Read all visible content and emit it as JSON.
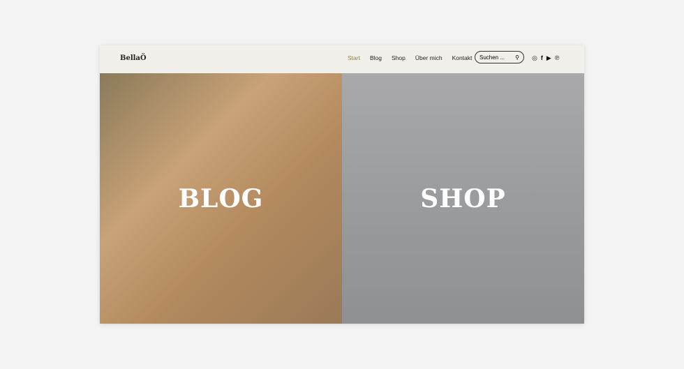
{
  "header": {
    "logo": "BellaÖ",
    "nav": [
      "Start",
      "Blog",
      "Shop",
      "Über mich",
      "Kontakt"
    ],
    "active_color": "#8b7a4a",
    "search_placeholder": "Suchen ...",
    "social": [
      "instagram-icon",
      "facebook-icon",
      "youtube-icon",
      "pinterest-icon"
    ]
  },
  "panels": {
    "blog": "BLOG",
    "shop": "SHOP"
  }
}
